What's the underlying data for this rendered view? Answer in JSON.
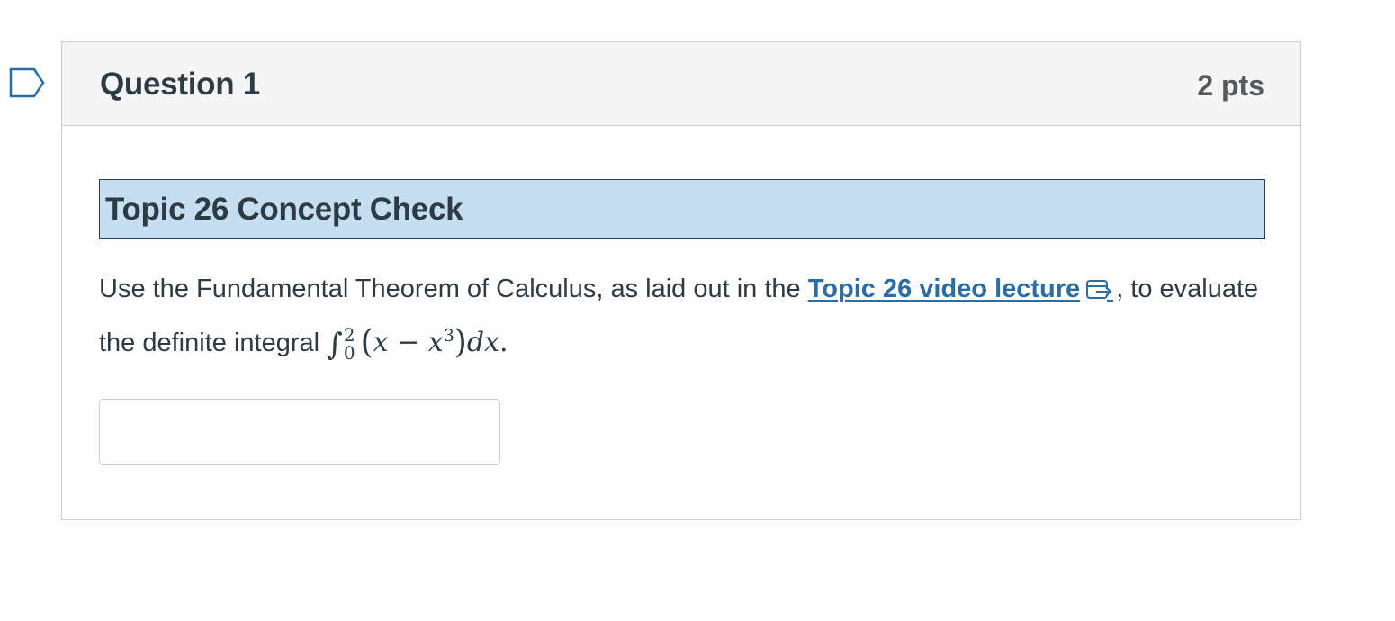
{
  "question": {
    "title": "Question 1",
    "points": "2 pts",
    "topic_heading": "Topic 26 Concept Check",
    "text_before_link": "Use the Fundamental Theorem of Calculus, as laid out in the ",
    "link_text": "Topic 26 video lecture",
    "text_after_link": ", to evaluate the definite integral ",
    "integral": {
      "symbol": "∫",
      "upper_limit": "2",
      "lower_limit": "0",
      "open_paren": "(",
      "var_x": "x",
      "minus": " − ",
      "var_x2": "x",
      "exponent": "3",
      "close_paren": ")",
      "differential": "dx",
      "period": "."
    },
    "answer_value": ""
  },
  "icons": {
    "flag": "bookmark-flag-icon",
    "external_link": "external-link-icon"
  },
  "colors": {
    "header_bg": "#f5f5f5",
    "topic_bg": "#c6def2",
    "link": "#2b6ca3",
    "text": "#2d3b45",
    "flag": "#2b6ca3"
  }
}
